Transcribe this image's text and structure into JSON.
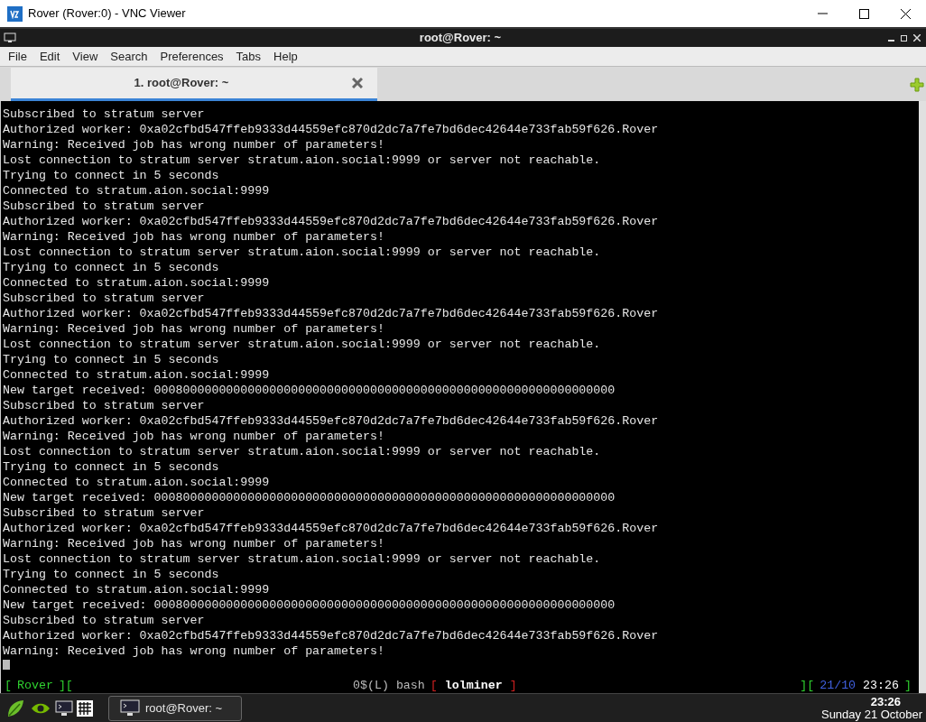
{
  "window": {
    "title": "Rover (Rover:0) - VNC Viewer"
  },
  "remote_window": {
    "title": "root@Rover: ~"
  },
  "menu": [
    "File",
    "Edit",
    "View",
    "Search",
    "Preferences",
    "Tabs",
    "Help"
  ],
  "tabs": [
    {
      "label": "1. root@Rover: ~",
      "selected": true
    }
  ],
  "terminal": {
    "lines": [
      "Subscribed to stratum server",
      "Authorized worker: 0xa02cfbd547ffeb9333d44559efc870d2dc7a7fe7bd6dec42644e733fab59f626.Rover",
      "Warning: Received job has wrong number of parameters!",
      "Lost connection to stratum server stratum.aion.social:9999 or server not reachable.",
      "Trying to connect in 5 seconds",
      "Connected to stratum.aion.social:9999",
      "Subscribed to stratum server",
      "Authorized worker: 0xa02cfbd547ffeb9333d44559efc870d2dc7a7fe7bd6dec42644e733fab59f626.Rover",
      "Warning: Received job has wrong number of parameters!",
      "Lost connection to stratum server stratum.aion.social:9999 or server not reachable.",
      "Trying to connect in 5 seconds",
      "Connected to stratum.aion.social:9999",
      "Subscribed to stratum server",
      "Authorized worker: 0xa02cfbd547ffeb9333d44559efc870d2dc7a7fe7bd6dec42644e733fab59f626.Rover",
      "Warning: Received job has wrong number of parameters!",
      "Lost connection to stratum server stratum.aion.social:9999 or server not reachable.",
      "Trying to connect in 5 seconds",
      "Connected to stratum.aion.social:9999",
      "New target received: 0008000000000000000000000000000000000000000000000000000000000000",
      "Subscribed to stratum server",
      "Authorized worker: 0xa02cfbd547ffeb9333d44559efc870d2dc7a7fe7bd6dec42644e733fab59f626.Rover",
      "Warning: Received job has wrong number of parameters!",
      "Lost connection to stratum server stratum.aion.social:9999 or server not reachable.",
      "Trying to connect in 5 seconds",
      "Connected to stratum.aion.social:9999",
      "New target received: 0008000000000000000000000000000000000000000000000000000000000000",
      "Subscribed to stratum server",
      "Authorized worker: 0xa02cfbd547ffeb9333d44559efc870d2dc7a7fe7bd6dec42644e733fab59f626.Rover",
      "Warning: Received job has wrong number of parameters!",
      "Lost connection to stratum server stratum.aion.social:9999 or server not reachable.",
      "Trying to connect in 5 seconds",
      "Connected to stratum.aion.social:9999",
      "New target received: 0008000000000000000000000000000000000000000000000000000000000000",
      "Subscribed to stratum server",
      "Authorized worker: 0xa02cfbd547ffeb9333d44559efc870d2dc7a7fe7bd6dec42644e733fab59f626.Rover",
      "Warning: Received job has wrong number of parameters!"
    ]
  },
  "tmux_status": {
    "left": [
      {
        "kind": "bracket",
        "text": "[",
        "color": "#2fd02f"
      },
      {
        "kind": "label",
        "text": "Rover",
        "color": "#2fd02f"
      },
      {
        "kind": "bracket",
        "text": "][",
        "color": "#2fd02f"
      }
    ],
    "center": [
      {
        "kind": "label",
        "text": "0$(L) bash",
        "color": "#bbbbbb"
      },
      {
        "kind": "bracket",
        "text": "[",
        "color": "#d02020"
      },
      {
        "kind": "active",
        "text": "lolminer",
        "color": "#ffffff"
      },
      {
        "kind": "bracket",
        "text": "]",
        "color": "#d02020"
      }
    ],
    "right": [
      {
        "kind": "bracket",
        "text": "][",
        "color": "#2fd02f"
      },
      {
        "kind": "label",
        "text": "21/10",
        "color": "#4060e0"
      },
      {
        "kind": "label",
        "text": "23:26",
        "color": "#ffffff"
      },
      {
        "kind": "bracket",
        "text": "]",
        "color": "#2fd02f"
      }
    ]
  },
  "taskbar": {
    "task": "root@Rover: ~",
    "clock_time": "23:26",
    "clock_date": "Sunday 21 October"
  }
}
